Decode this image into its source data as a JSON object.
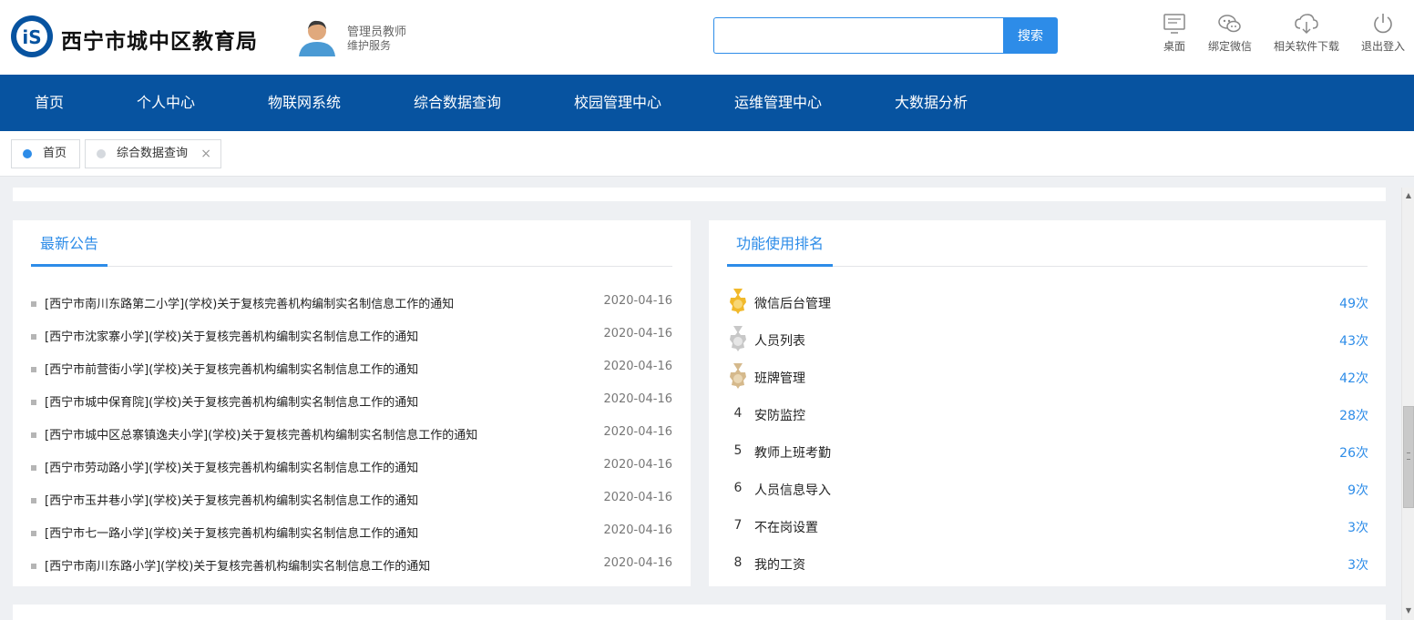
{
  "header": {
    "site_title": "西宁市城中区教育局",
    "logo_text": "iS",
    "user_role": "管理员教师",
    "user_sub": "维护服务",
    "search_placeholder": "",
    "search_button": "搜索",
    "tools": [
      {
        "label": "桌面",
        "icon": "desktop-icon"
      },
      {
        "label": "绑定微信",
        "icon": "wechat-icon"
      },
      {
        "label": "相关软件下载",
        "icon": "cloud-download-icon"
      },
      {
        "label": "退出登入",
        "icon": "power-icon"
      }
    ]
  },
  "nav": {
    "items": [
      "首页",
      "个人中心",
      "物联网系统",
      "综合数据查询",
      "校园管理中心",
      "运维管理中心",
      "大数据分析"
    ]
  },
  "tabs": [
    {
      "label": "首页",
      "active": true,
      "closable": false
    },
    {
      "label": "综合数据查询",
      "active": false,
      "closable": true,
      "close_glyph": "×"
    }
  ],
  "notices": {
    "title": "最新公告",
    "items": [
      {
        "text": "[西宁市南川东路第二小学](学校)关于复核完善机构编制实名制信息工作的通知",
        "date": "2020-04-16"
      },
      {
        "text": "[西宁市沈家寨小学](学校)关于复核完善机构编制实名制信息工作的通知",
        "date": "2020-04-16"
      },
      {
        "text": "[西宁市前营街小学](学校)关于复核完善机构编制实名制信息工作的通知",
        "date": "2020-04-16"
      },
      {
        "text": "[西宁市城中保育院](学校)关于复核完善机构编制实名制信息工作的通知",
        "date": "2020-04-16"
      },
      {
        "text": "[西宁市城中区总寨镇逸夫小学](学校)关于复核完善机构编制实名制信息工作的通知",
        "date": "2020-04-16"
      },
      {
        "text": "[西宁市劳动路小学](学校)关于复核完善机构编制实名制信息工作的通知",
        "date": "2020-04-16"
      },
      {
        "text": "[西宁市玉井巷小学](学校)关于复核完善机构编制实名制信息工作的通知",
        "date": "2020-04-16"
      },
      {
        "text": "[西宁市七一路小学](学校)关于复核完善机构编制实名制信息工作的通知",
        "date": "2020-04-16"
      },
      {
        "text": "[西宁市南川东路小学](学校)关于复核完善机构编制实名制信息工作的通知",
        "date": "2020-04-16"
      }
    ]
  },
  "ranking": {
    "title": "功能使用排名",
    "items": [
      {
        "rank": "1",
        "name": "微信后台管理",
        "count": "49次",
        "medal": "gold"
      },
      {
        "rank": "2",
        "name": "人员列表",
        "count": "43次",
        "medal": "silver"
      },
      {
        "rank": "3",
        "name": "班牌管理",
        "count": "42次",
        "medal": "bronze"
      },
      {
        "rank": "4",
        "name": "安防监控",
        "count": "28次"
      },
      {
        "rank": "5",
        "name": "教师上班考勤",
        "count": "26次"
      },
      {
        "rank": "6",
        "name": "人员信息导入",
        "count": "9次"
      },
      {
        "rank": "7",
        "name": "不在岗设置",
        "count": "3次"
      },
      {
        "rank": "8",
        "name": "我的工资",
        "count": "3次"
      }
    ]
  },
  "colors": {
    "brand_blue": "#0753a0",
    "accent_blue": "#2d8ce8",
    "medal_gold": "#f1b92b",
    "medal_silver": "#c8c8c8",
    "medal_bronze": "#d5b98c"
  }
}
